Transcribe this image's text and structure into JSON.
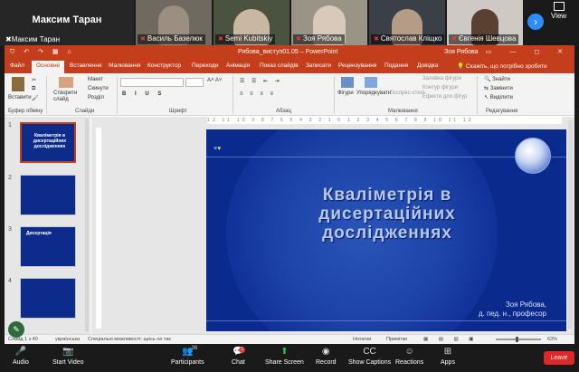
{
  "gallery": {
    "speaker_name": "Максим Таран",
    "speaker_small": "Максим Таран",
    "participants": [
      {
        "name": "Василь Базелюк"
      },
      {
        "name": "Semi Kubitskiy"
      },
      {
        "name": "Зоя Рябова"
      },
      {
        "name": "Святослав Кліщко"
      },
      {
        "name": "Євгенія Шевцова"
      }
    ],
    "view_label": "View"
  },
  "ppt": {
    "quick_access": "⛉ ↶ ↷ ▦ ⌂",
    "document_title": "Рябова_виступ01.05 – PowerPoint",
    "user_name": "Зоя Рябова",
    "window_controls": "▭ — ◻ ✕",
    "tabs": [
      "Файл",
      "Основне",
      "Вставлення",
      "Малювання",
      "Конструктор",
      "Переходи",
      "Анімація",
      "Показ слайдів",
      "Записати",
      "Рецензування",
      "Подання",
      "Довідка"
    ],
    "active_tab": "Основне",
    "tell_me": "Скажіть, що потрібно зробити",
    "ribbon": {
      "paste": "Вставити",
      "clipboard_group": "Буфер обміну",
      "new_slide": "Створити слайд",
      "layout": "Макет",
      "reset": "Скинути",
      "section": "Розділ",
      "slides_group": "Слайди",
      "font_group": "Шрифт",
      "paragraph_group": "Абзац",
      "shapes": "Фігури",
      "arrange": "Упорядкувати",
      "quick_styles": "Експрес-стилі",
      "shape_fill": "Заливка фігури",
      "shape_outline": "Контур фігури",
      "shape_effects": "Ефекти для фігур",
      "drawing_group": "Малювання",
      "find": "Знайти",
      "replace": "Замінити",
      "select": "Виділити",
      "editing_group": "Редагування"
    },
    "thumbnails": [
      {
        "no": "1",
        "text": "Кваліметрія в дисертаційних дослідженнях"
      },
      {
        "no": "2",
        "text": ""
      },
      {
        "no": "3",
        "text": "Дисертація"
      },
      {
        "no": "4",
        "text": ""
      }
    ],
    "ruler_text": "12 11 10 9 8 7 6 5 4 3 2 1 0 1 2 3 4 5 6 7 8 9 10 11 12",
    "slide": {
      "title_line1": "Кваліметрія в",
      "title_line2": "дисертаційних",
      "title_line3": "дослідженнях",
      "author_line1": "Зоя Рябова,",
      "author_line2": "д. пед. н., професор"
    },
    "status": {
      "slide_no": "Слайд 1 з 40",
      "language": "українська",
      "accessibility": "Спеціальні можливості: щось не так",
      "notes": "Нотатки",
      "comments": "Примітки",
      "zoom": "63%"
    }
  },
  "zoom_toolbar": {
    "audio": "Audio",
    "video": "Start Video",
    "participants": "Participants",
    "participants_count": "36",
    "chat": "Chat",
    "chat_badge": "1",
    "share": "Share Screen",
    "record": "Record",
    "captions": "Show Captions",
    "reactions": "Reactions",
    "apps": "Apps",
    "leave": "Leave"
  }
}
